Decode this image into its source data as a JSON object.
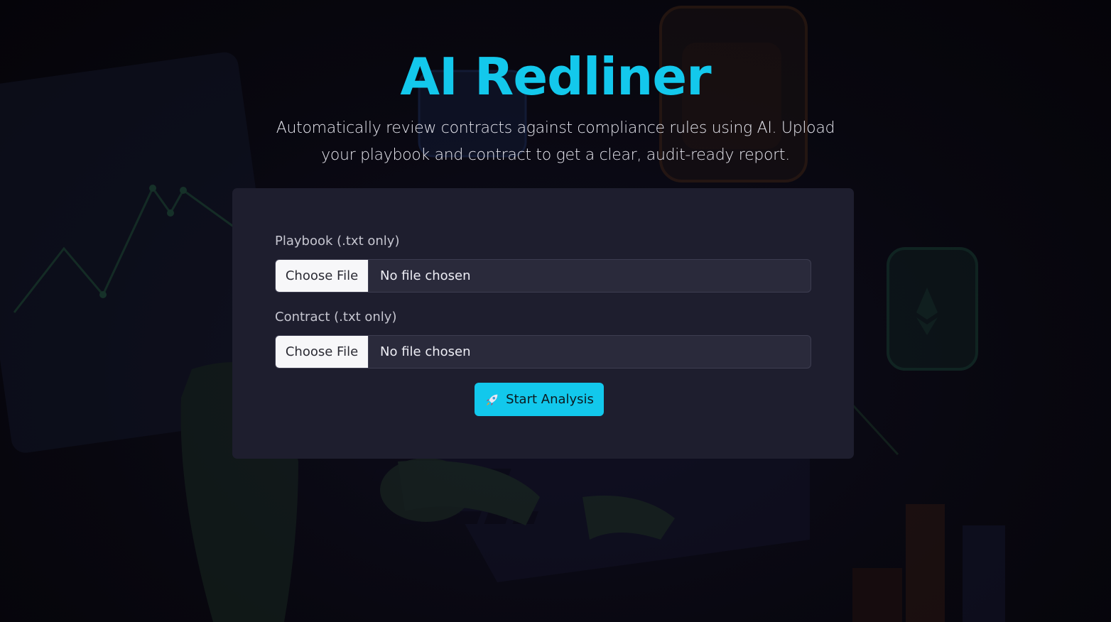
{
  "hero": {
    "title": "AI Redliner",
    "subtitle": "Automatically review contracts against compliance rules using AI. Upload your playbook and contract to get a clear, audit-ready report."
  },
  "form": {
    "playbook": {
      "label": "Playbook (.txt only)",
      "button_label": "Choose File",
      "status": "No file chosen"
    },
    "contract": {
      "label": "Contract (.txt only)",
      "button_label": "Choose File",
      "status": "No file chosen"
    },
    "submit": {
      "icon": "rocket-icon",
      "label": "Start Analysis"
    }
  },
  "colors": {
    "accent": "#13c8ec",
    "card": "#1e1e2e",
    "background": "#07060f"
  }
}
